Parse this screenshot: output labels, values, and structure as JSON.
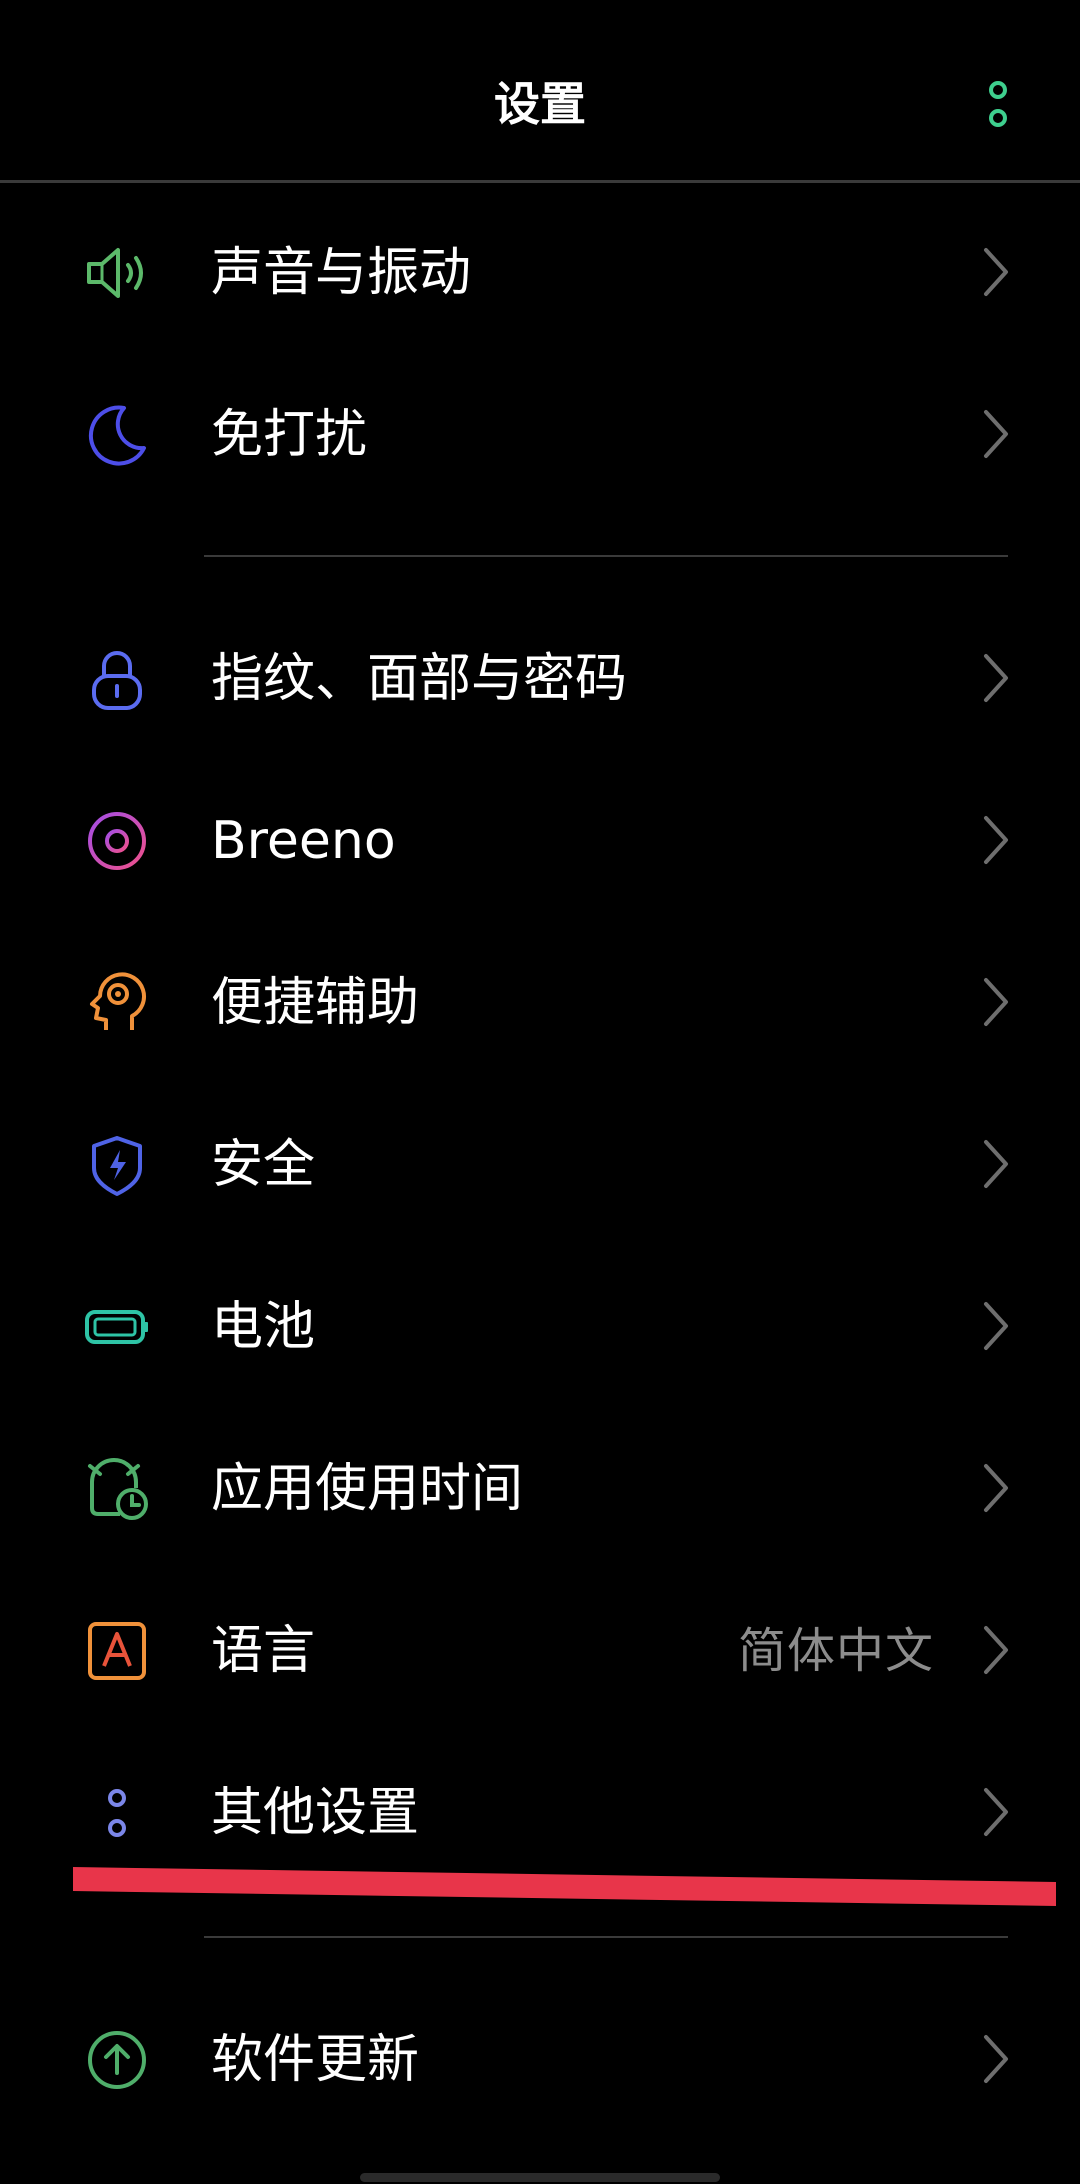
{
  "header": {
    "title": "设置",
    "more_icon": "more-vertical-icon"
  },
  "items": [
    {
      "label": "声音与振动",
      "icon": "speaker-icon"
    },
    {
      "label": "免打扰",
      "icon": "moon-icon"
    },
    {
      "label": "指纹、面部与密码",
      "icon": "lock-icon"
    },
    {
      "label": "Breeno",
      "icon": "breeno-icon"
    },
    {
      "label": "便捷辅助",
      "icon": "assist-head-icon"
    },
    {
      "label": "安全",
      "icon": "shield-icon"
    },
    {
      "label": "电池",
      "icon": "battery-icon"
    },
    {
      "label": "应用使用时间",
      "icon": "alarm-clock-icon"
    },
    {
      "label": "语言",
      "value": "简体中文",
      "icon": "language-icon"
    },
    {
      "label": "其他设置",
      "icon": "more-settings-icon"
    },
    {
      "label": "软件更新",
      "icon": "update-arrow-icon"
    }
  ],
  "colors": {
    "background": "#000000",
    "accent_green": "#3ecf8e",
    "annotation_red": "#e8354a"
  }
}
